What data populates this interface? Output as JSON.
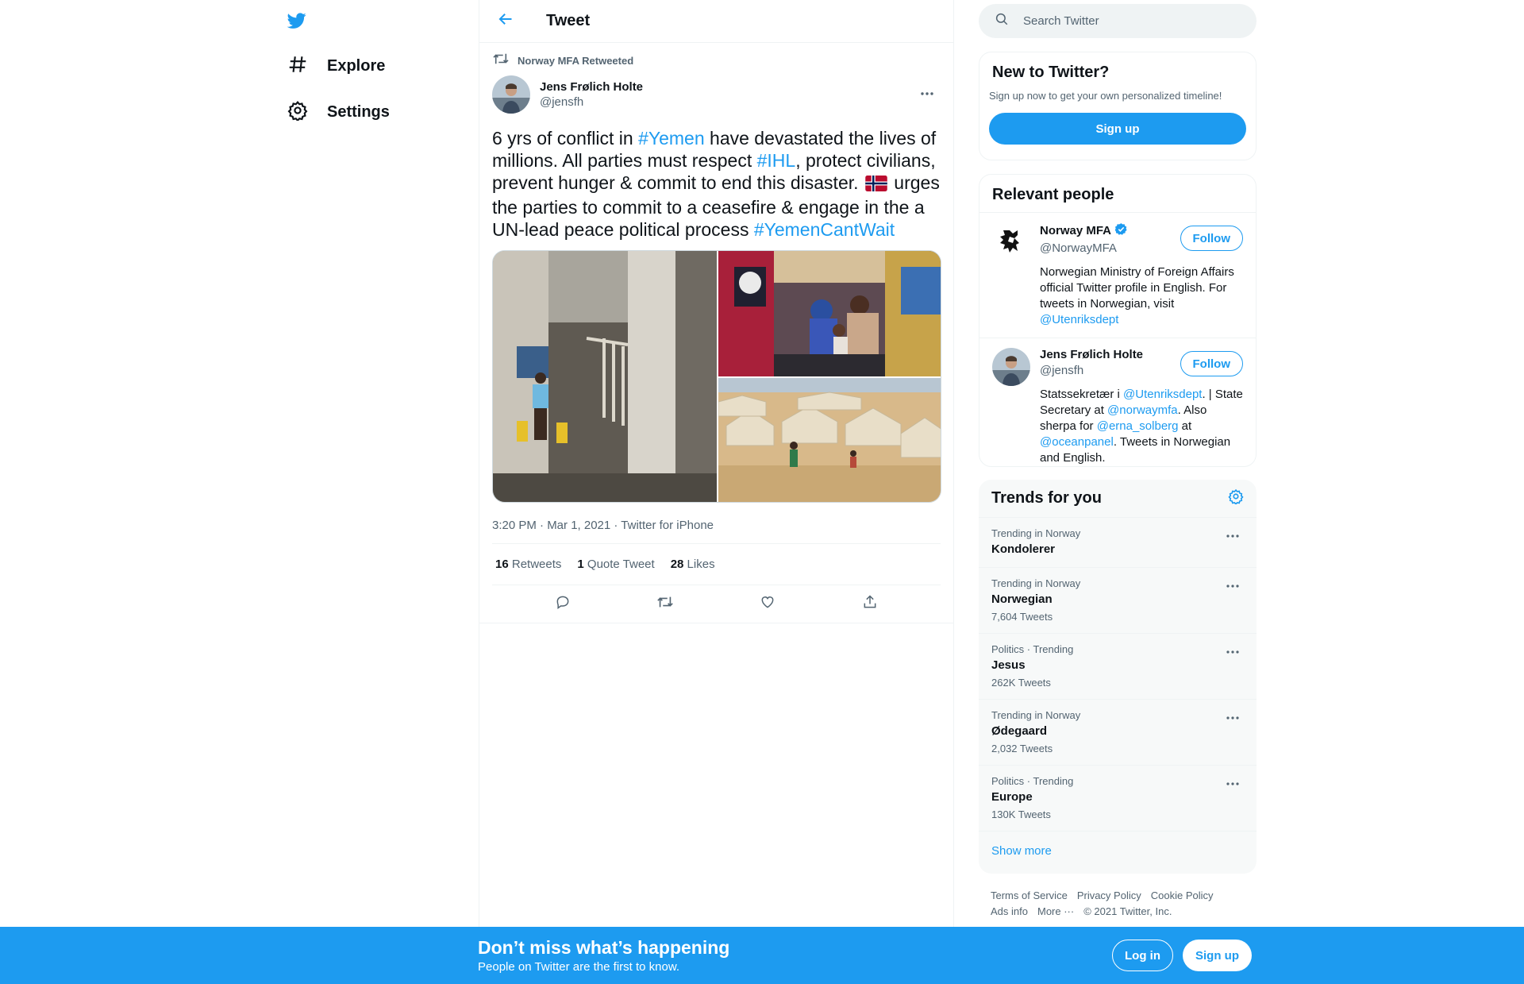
{
  "nav": {
    "logo_icon": "twitter-bird-icon",
    "items": [
      {
        "label": "Explore",
        "icon": "hashtag-icon"
      },
      {
        "label": "Settings",
        "icon": "gear-icon"
      }
    ]
  },
  "header": {
    "title": "Tweet",
    "back_icon": "arrow-left-icon"
  },
  "tweet": {
    "retweeted_by": "Norway MFA Retweeted",
    "author_name": "Jens Frølich Holte",
    "author_handle": "@jensfh",
    "text_parts": {
      "p1": "6 yrs of conflict in ",
      "tag1": "#Yemen",
      "p2": " have devastated the lives of millions. All parties must respect ",
      "tag2": "#IHL",
      "p3": ", protect civilians, prevent hunger & commit to end this disaster. ",
      "p4": " urges the parties to commit to a ceasefire & engage in the a UN-lead peace political process ",
      "tag3": "#YemenCantWait"
    },
    "flag_icon": "norway-flag-icon",
    "timestamp": "3:20 PM · Mar 1, 2021 · Twitter for iPhone",
    "stats": {
      "retweets_count": "16",
      "retweets_label": "Retweets",
      "quotes_count": "1",
      "quotes_label": "Quote Tweet",
      "likes_count": "28",
      "likes_label": "Likes"
    }
  },
  "search": {
    "placeholder": "Search Twitter"
  },
  "new_to_twitter": {
    "title": "New to Twitter?",
    "subtitle": "Sign up now to get your own personalized timeline!",
    "button": "Sign up"
  },
  "relevant_people": {
    "title": "Relevant people",
    "people": [
      {
        "name": "Norway MFA",
        "handle": "@NorwayMFA",
        "verified": true,
        "follow": "Follow",
        "bio_text": "Norwegian Ministry of Foreign Affairs official Twitter profile in English. For tweets in Norwegian, visit ",
        "bio_link": "@Utenriksdept"
      },
      {
        "name": "Jens Frølich Holte",
        "handle": "@jensfh",
        "follow": "Follow",
        "bio_1": "Statssekretær i ",
        "bio_link1": "@Utenriksdept",
        "bio_2": ". | State Secretary at ",
        "bio_link2": "@norwaymfa",
        "bio_3": ". Also sherpa for ",
        "bio_link3": "@erna_solberg",
        "bio_4": " at ",
        "bio_link4": "@oceanpanel",
        "bio_5": ". Tweets in Norwegian and English."
      }
    ]
  },
  "trends": {
    "title": "Trends for you",
    "items": [
      {
        "meta": "Trending in Norway",
        "name": "Kondolerer",
        "count": ""
      },
      {
        "meta": "Trending in Norway",
        "name": "Norwegian",
        "count": "7,604 Tweets"
      },
      {
        "meta": "Politics · Trending",
        "name": "Jesus",
        "count": "262K Tweets"
      },
      {
        "meta": "Trending in Norway",
        "name": "Ødegaard",
        "count": "2,032 Tweets"
      },
      {
        "meta": "Politics · Trending",
        "name": "Europe",
        "count": "130K Tweets"
      }
    ],
    "show_more": "Show more"
  },
  "footer": {
    "terms": "Terms of Service",
    "privacy": "Privacy Policy",
    "cookie": "Cookie Policy",
    "ads": "Ads info",
    "more": "More ···",
    "copyright": "© 2021 Twitter, Inc."
  },
  "bottom_bar": {
    "title": "Don’t miss what’s happening",
    "subtitle": "People on Twitter are the first to know.",
    "login": "Log in",
    "signup": "Sign up"
  },
  "colors": {
    "accent": "#1d9bf0",
    "text": "#0f1419",
    "muted": "#536471"
  }
}
